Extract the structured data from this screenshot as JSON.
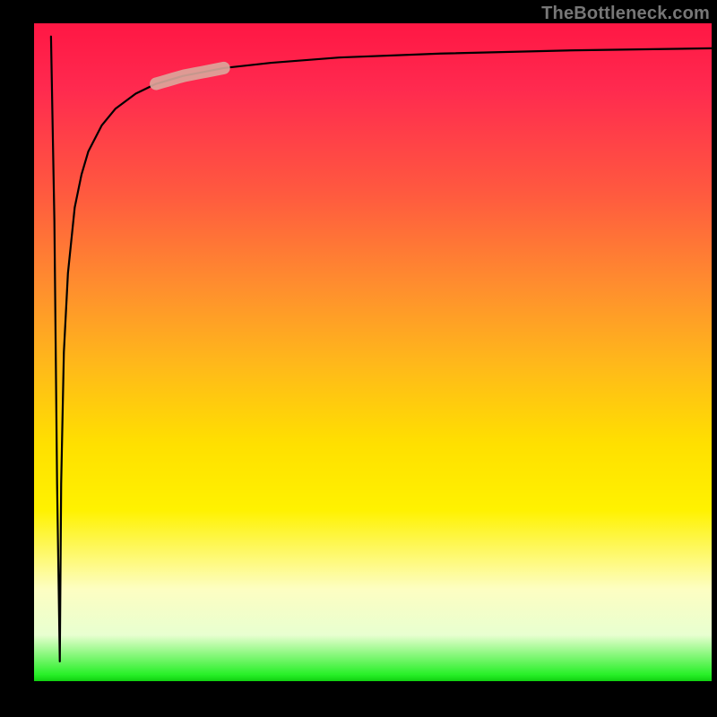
{
  "attribution": "TheBottleneck.com",
  "chart_data": {
    "type": "line",
    "title": "",
    "xlabel": "",
    "ylabel": "",
    "xlim": [
      0,
      100
    ],
    "ylim": [
      0,
      100
    ],
    "background_gradient": {
      "direction": "top-to-bottom",
      "stops": [
        {
          "pos": 0.0,
          "color": "#ff1744"
        },
        {
          "pos": 0.1,
          "color": "#ff2a4f"
        },
        {
          "pos": 0.26,
          "color": "#ff5a3f"
        },
        {
          "pos": 0.4,
          "color": "#ff8e2e"
        },
        {
          "pos": 0.52,
          "color": "#ffb91a"
        },
        {
          "pos": 0.64,
          "color": "#ffe000"
        },
        {
          "pos": 0.74,
          "color": "#fff200"
        },
        {
          "pos": 0.86,
          "color": "#fdfec2"
        },
        {
          "pos": 0.93,
          "color": "#e8ffd0"
        },
        {
          "pos": 0.99,
          "color": "#28f028"
        },
        {
          "pos": 1.0,
          "color": "#10d010"
        }
      ]
    },
    "series": [
      {
        "name": "curve",
        "x": [
          2.5,
          3.0,
          3.4,
          3.8,
          4.0,
          4.4,
          5.0,
          6.0,
          7.0,
          8.0,
          10.0,
          12.0,
          15.0,
          18.0,
          22.0,
          28.0,
          35.0,
          45.0,
          60.0,
          80.0,
          100.0
        ],
        "y": [
          98.0,
          70.0,
          30.0,
          3.0,
          30.0,
          50.0,
          62.0,
          72.0,
          77.0,
          80.5,
          84.5,
          87.0,
          89.3,
          90.8,
          92.0,
          93.2,
          94.0,
          94.8,
          95.4,
          95.9,
          96.2
        ]
      }
    ],
    "highlight_segment": {
      "series": "curve",
      "x_range": [
        18.0,
        28.0
      ],
      "color": "#dba79c",
      "width": 14
    }
  }
}
